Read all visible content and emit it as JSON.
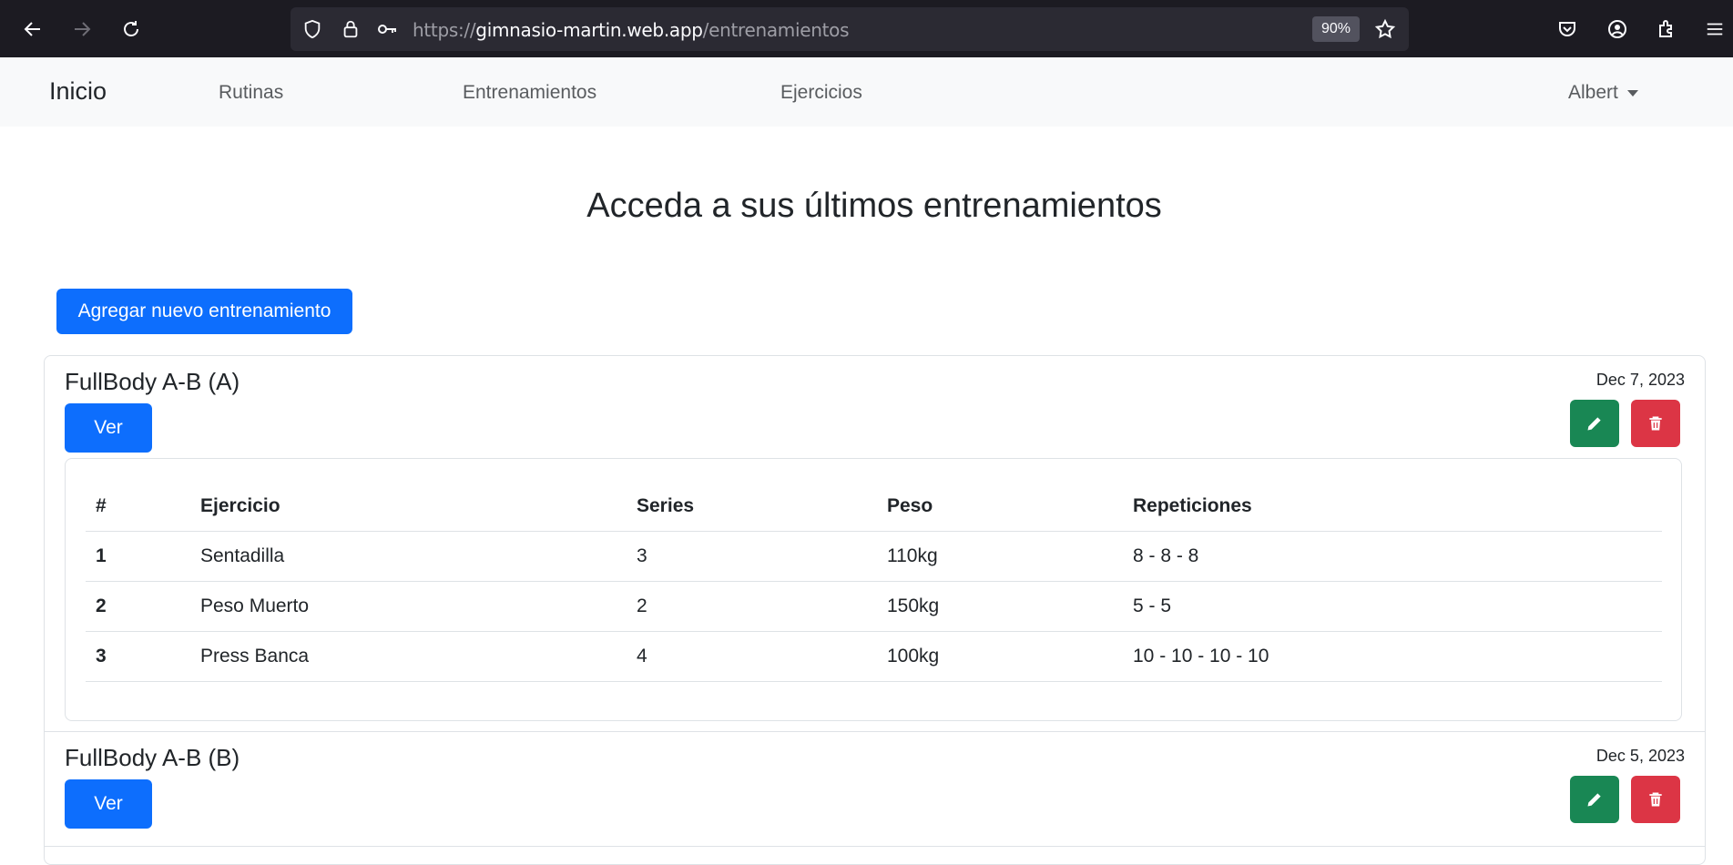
{
  "browser": {
    "url_prefix": "https://",
    "url_host": "gimnasio-martin.web.app",
    "url_path": "/entrenamientos",
    "zoom": "90%"
  },
  "navbar": {
    "brand": "Inicio",
    "links": [
      "Rutinas",
      "Entrenamientos",
      "Ejercicios"
    ],
    "user": "Albert"
  },
  "page": {
    "title": "Acceda a sus últimos entrenamientos",
    "add_button": "Agregar nuevo entrenamiento"
  },
  "workouts": [
    {
      "title": "FullBody A-B (A)",
      "date": "Dec 7, 2023",
      "view_label": "Ver",
      "table": {
        "headers": [
          "#",
          "Ejercicio",
          "Series",
          "Peso",
          "Repeticiones"
        ],
        "rows": [
          [
            "1",
            "Sentadilla",
            "3",
            "110kg",
            "8 - 8 - 8"
          ],
          [
            "2",
            "Peso Muerto",
            "2",
            "150kg",
            "5 - 5"
          ],
          [
            "3",
            "Press Banca",
            "4",
            "100kg",
            "10 - 10 - 10 - 10"
          ]
        ]
      }
    },
    {
      "title": "FullBody A-B (B)",
      "date": "Dec 5, 2023",
      "view_label": "Ver"
    }
  ],
  "colors": {
    "primary": "#0d6efd",
    "success": "#198754",
    "danger": "#dc3545"
  }
}
